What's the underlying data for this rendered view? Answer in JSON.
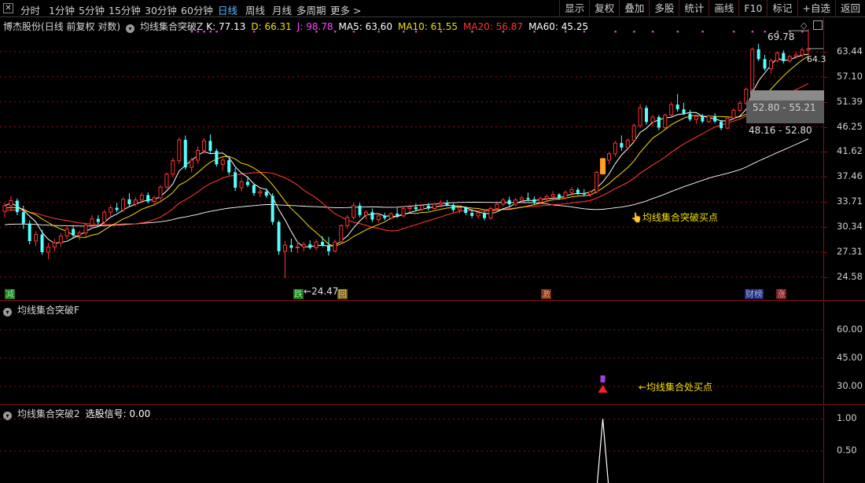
{
  "toolbar": {
    "periods": [
      "分时",
      "1分钟",
      "5分钟",
      "15分钟",
      "30分钟",
      "60分钟",
      "日线",
      "周线",
      "月线",
      "多周期",
      "更多 >"
    ],
    "selected": "日线",
    "right_buttons": [
      "显示",
      "复权",
      "叠加",
      "多股",
      "统计",
      "画线",
      "F10",
      "标记",
      "+自选",
      "返回"
    ]
  },
  "main": {
    "stock_name": "博杰股份",
    "mode": "(日线 前复权 对数)",
    "indicator_name": "均线集合突破Z",
    "k_label": "K: 77.13",
    "d_label": "D: 66.31",
    "j_label": "J: 98.78",
    "ma5_label": "MA5: 63.60",
    "ma10_label": "MA10: 61.55",
    "ma20_label": "MA20: 56.87",
    "ma60_label": "MA60: 45.25",
    "y_ticks": [
      "63.44",
      "57.10",
      "51.39",
      "46.25",
      "41.62",
      "37.46",
      "33.71",
      "30.34",
      "27.31",
      "24.58"
    ],
    "high_label": "69.78",
    "last_label": "64.3",
    "low_label": "24.47",
    "range_upper": "52.80 - 55.21",
    "range_lower": "48.16 - 52.80",
    "buy_note": "均线集合突破买点",
    "badges": [
      {
        "text": "减"
      },
      {
        "text": "跌"
      },
      {
        "text": "回"
      },
      {
        "text": "激"
      },
      {
        "text": "财榜"
      },
      {
        "text": "涨"
      }
    ]
  },
  "panel_f": {
    "title": "均线集合突破F",
    "y_ticks": [
      "60.00",
      "45.00",
      "30.00"
    ],
    "buy_note": "←均线集合处买点"
  },
  "panel_2": {
    "title": "均线集合突破2",
    "signal_label": "选股信号: 0.00",
    "y_ticks": [
      "1.00",
      "0.50"
    ]
  },
  "colors": {
    "up": "#ff3232",
    "down": "#54ffff",
    "ma5": "#ffffff",
    "ma10": "#f0e000",
    "ma20": "#ff3232",
    "ma60": "#ffffff",
    "k": "#ffffff",
    "d": "#f0e000",
    "j": "#ff44ff",
    "grid": "#8a1010"
  },
  "chart_data": {
    "type": "candlestick",
    "y_scale": "log",
    "ylim": [
      24.0,
      70.5
    ],
    "candles": [
      [
        32.4,
        33.6,
        31.6,
        33.2
      ],
      [
        33.2,
        34.6,
        32.4,
        33.9
      ],
      [
        33.9,
        34.2,
        31.9,
        32.3
      ],
      [
        32.3,
        33.2,
        30.1,
        30.8
      ],
      [
        30.8,
        31.2,
        28.2,
        28.6
      ],
      [
        28.6,
        29.8,
        28.0,
        29.4
      ],
      [
        29.4,
        30.0,
        27.0,
        27.3
      ],
      [
        27.3,
        28.4,
        26.5,
        27.9
      ],
      [
        27.9,
        28.9,
        27.4,
        28.4
      ],
      [
        28.4,
        29.6,
        27.9,
        29.2
      ],
      [
        29.2,
        30.6,
        28.8,
        30.1
      ],
      [
        30.1,
        30.6,
        28.9,
        29.3
      ],
      [
        29.3,
        29.9,
        28.7,
        29.6
      ],
      [
        29.6,
        30.9,
        29.1,
        30.6
      ],
      [
        30.6,
        31.9,
        30.2,
        31.4
      ],
      [
        31.4,
        31.9,
        30.6,
        31.0
      ],
      [
        31.0,
        32.6,
        30.7,
        32.3
      ],
      [
        32.3,
        33.3,
        31.7,
        32.9
      ],
      [
        32.9,
        33.6,
        32.3,
        32.6
      ],
      [
        32.6,
        34.4,
        32.3,
        34.1
      ],
      [
        34.1,
        35.0,
        33.1,
        33.4
      ],
      [
        33.4,
        34.4,
        33.1,
        34.0
      ],
      [
        34.0,
        35.1,
        33.5,
        34.7
      ],
      [
        34.7,
        35.1,
        33.5,
        33.8
      ],
      [
        33.8,
        34.6,
        33.2,
        34.3
      ],
      [
        34.3,
        36.2,
        34.0,
        35.9
      ],
      [
        35.9,
        38.2,
        35.6,
        37.9
      ],
      [
        37.9,
        40.6,
        37.4,
        40.1
      ],
      [
        40.1,
        44.2,
        39.6,
        43.8
      ],
      [
        43.8,
        44.6,
        38.6,
        39.0
      ],
      [
        39.0,
        40.6,
        38.2,
        40.2
      ],
      [
        40.2,
        42.6,
        39.6,
        41.9
      ],
      [
        41.9,
        44.1,
        41.3,
        43.6
      ],
      [
        43.6,
        44.8,
        41.4,
        41.8
      ],
      [
        41.8,
        42.2,
        39.1,
        39.5
      ],
      [
        39.5,
        40.8,
        38.5,
        40.2
      ],
      [
        40.2,
        40.6,
        37.8,
        38.2
      ],
      [
        38.2,
        38.9,
        35.3,
        35.8
      ],
      [
        35.8,
        37.2,
        35.2,
        36.7
      ],
      [
        36.7,
        37.6,
        35.9,
        36.2
      ],
      [
        36.2,
        36.4,
        34.6,
        35.0
      ],
      [
        35.0,
        35.7,
        34.4,
        35.2
      ],
      [
        35.2,
        35.7,
        34.3,
        34.6
      ],
      [
        34.6,
        35.0,
        30.6,
        31.0
      ],
      [
        31.0,
        31.2,
        27.0,
        27.4
      ],
      [
        27.4,
        28.6,
        24.47,
        28.1
      ],
      [
        28.1,
        28.9,
        27.3,
        27.8
      ],
      [
        27.8,
        28.6,
        27.2,
        27.9
      ],
      [
        27.9,
        28.5,
        27.4,
        28.2
      ],
      [
        28.2,
        28.7,
        27.6,
        27.8
      ],
      [
        27.8,
        28.8,
        27.5,
        28.5
      ],
      [
        28.5,
        29.2,
        27.9,
        28.1
      ],
      [
        28.1,
        29.1,
        26.9,
        27.4
      ],
      [
        27.4,
        28.8,
        27.3,
        28.5
      ],
      [
        28.5,
        30.7,
        28.3,
        30.5
      ],
      [
        30.5,
        31.9,
        30.1,
        31.6
      ],
      [
        31.6,
        33.6,
        31.3,
        33.2
      ],
      [
        33.2,
        33.6,
        31.6,
        31.9
      ],
      [
        31.9,
        32.6,
        31.3,
        32.3
      ],
      [
        32.3,
        32.8,
        31.0,
        31.3
      ],
      [
        31.3,
        32.1,
        30.9,
        31.8
      ],
      [
        31.8,
        32.2,
        31.2,
        31.5
      ],
      [
        31.5,
        32.3,
        31.3,
        32.1
      ],
      [
        32.1,
        32.9,
        31.5,
        31.8
      ],
      [
        31.8,
        33.1,
        31.6,
        32.8
      ],
      [
        32.8,
        33.3,
        32.3,
        33.0
      ],
      [
        33.0,
        33.5,
        32.5,
        32.7
      ],
      [
        32.7,
        33.4,
        32.4,
        33.2
      ],
      [
        33.2,
        33.6,
        32.5,
        32.8
      ],
      [
        32.8,
        33.6,
        32.6,
        33.4
      ],
      [
        33.4,
        34.0,
        33.0,
        33.6
      ],
      [
        33.6,
        34.0,
        33.1,
        33.3
      ],
      [
        33.3,
        33.5,
        32.3,
        32.6
      ],
      [
        32.6,
        33.2,
        32.1,
        32.9
      ],
      [
        32.9,
        33.1,
        31.9,
        32.2
      ],
      [
        32.2,
        32.7,
        31.5,
        31.8
      ],
      [
        31.8,
        32.4,
        31.4,
        32.2
      ],
      [
        32.2,
        32.4,
        31.2,
        31.5
      ],
      [
        31.5,
        33.1,
        31.3,
        32.8
      ],
      [
        32.8,
        33.6,
        32.6,
        33.4
      ],
      [
        33.4,
        34.3,
        33.1,
        34.0
      ],
      [
        34.0,
        34.5,
        33.1,
        33.4
      ],
      [
        33.4,
        34.3,
        33.1,
        34.0
      ],
      [
        34.0,
        34.6,
        33.6,
        34.3
      ],
      [
        34.3,
        35.1,
        33.8,
        34.1
      ],
      [
        34.1,
        34.5,
        33.3,
        33.7
      ],
      [
        33.7,
        34.5,
        33.4,
        34.2
      ],
      [
        34.2,
        34.8,
        33.7,
        34.5
      ],
      [
        34.5,
        35.3,
        34.1,
        34.8
      ],
      [
        34.8,
        35.0,
        34.0,
        34.3
      ],
      [
        34.3,
        35.4,
        34.1,
        35.1
      ],
      [
        35.1,
        35.9,
        34.6,
        35.5
      ],
      [
        35.5,
        35.8,
        34.7,
        35.0
      ],
      [
        35.0,
        35.6,
        34.5,
        34.8
      ],
      [
        34.8,
        35.4,
        34.4,
        35.2
      ],
      [
        35.2,
        38.4,
        35.0,
        38.2
      ],
      [
        38.2,
        40.6,
        37.8,
        40.2
      ],
      [
        40.2,
        41.6,
        39.5,
        41.3
      ],
      [
        41.3,
        43.6,
        40.8,
        43.2
      ],
      [
        43.2,
        44.6,
        41.8,
        42.4
      ],
      [
        42.4,
        44.1,
        42.0,
        43.7
      ],
      [
        43.7,
        46.9,
        43.4,
        46.5
      ],
      [
        46.5,
        50.9,
        46.0,
        50.1
      ],
      [
        50.1,
        50.6,
        46.7,
        47.2
      ],
      [
        47.2,
        48.6,
        46.4,
        48.2
      ],
      [
        48.2,
        48.6,
        45.6,
        46.1
      ],
      [
        46.1,
        48.9,
        45.8,
        48.6
      ],
      [
        48.6,
        51.3,
        48.2,
        50.8
      ],
      [
        50.8,
        53.1,
        49.3,
        49.8
      ],
      [
        49.8,
        51.2,
        48.6,
        48.9
      ],
      [
        48.9,
        49.7,
        47.3,
        47.7
      ],
      [
        47.7,
        48.6,
        46.9,
        48.3
      ],
      [
        48.3,
        48.8,
        47.0,
        47.3
      ],
      [
        47.3,
        48.7,
        47.0,
        48.4
      ],
      [
        48.4,
        49.0,
        47.0,
        47.3
      ],
      [
        47.3,
        47.6,
        45.6,
        46.0
      ],
      [
        46.0,
        48.3,
        45.8,
        48.0
      ],
      [
        48.0,
        50.0,
        47.7,
        49.6
      ],
      [
        49.6,
        51.6,
        49.1,
        51.1
      ],
      [
        51.1,
        54.6,
        50.8,
        54.2
      ],
      [
        54.2,
        64.6,
        53.9,
        64.1
      ],
      [
        64.1,
        65.6,
        61.0,
        61.5
      ],
      [
        61.5,
        62.6,
        58.6,
        59.1
      ],
      [
        59.1,
        61.6,
        57.8,
        61.1
      ],
      [
        61.1,
        63.6,
        60.6,
        63.1
      ],
      [
        63.1,
        63.8,
        60.4,
        61.0
      ],
      [
        61.0,
        62.6,
        60.6,
        62.2
      ],
      [
        62.2,
        63.6,
        61.6,
        62.6
      ],
      [
        62.6,
        64.6,
        62.0,
        63.9
      ],
      [
        63.9,
        69.78,
        62.5,
        64.3
      ]
    ],
    "panel_f_ylim": [
      20,
      75
    ],
    "panel_2_ylim": [
      0,
      1.2
    ],
    "buy_signal_index": 96
  }
}
